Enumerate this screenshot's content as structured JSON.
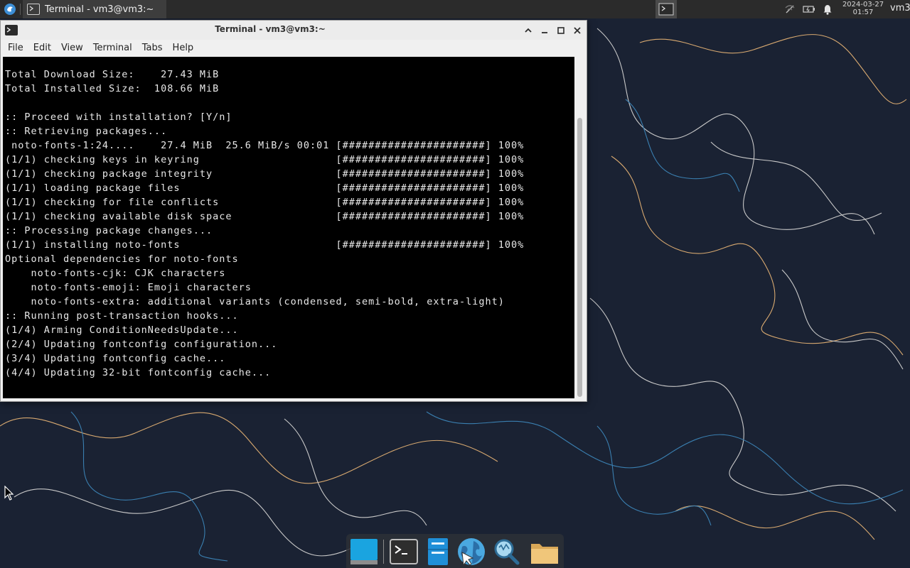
{
  "top_panel": {
    "task_label": "Terminal - vm3@vm3:~",
    "clock_date": "2024-03-27",
    "clock_time": "01:57",
    "user": "vm3",
    "icons": [
      "app-menu-icon",
      "terminal-icon",
      "workspace-icon",
      "network-off-icon",
      "battery-icon",
      "notification-bell-icon"
    ]
  },
  "window": {
    "title": "Terminal - vm3@vm3:~",
    "menu": [
      "File",
      "Edit",
      "View",
      "Terminal",
      "Tabs",
      "Help"
    ]
  },
  "terminal": {
    "lines": [
      "Total Download Size:    27.43 MiB",
      "Total Installed Size:  108.66 MiB",
      "",
      ":: Proceed with installation? [Y/n]",
      ":: Retrieving packages...",
      " noto-fonts-1:24....    27.4 MiB  25.6 MiB/s 00:01 [######################] 100%",
      "(1/1) checking keys in keyring                     [######################] 100%",
      "(1/1) checking package integrity                   [######################] 100%",
      "(1/1) loading package files                        [######################] 100%",
      "(1/1) checking for file conflicts                  [######################] 100%",
      "(1/1) checking available disk space                [######################] 100%",
      ":: Processing package changes...",
      "(1/1) installing noto-fonts                        [######################] 100%",
      "Optional dependencies for noto-fonts",
      "    noto-fonts-cjk: CJK characters",
      "    noto-fonts-emoji: Emoji characters",
      "    noto-fonts-extra: additional variants (condensed, semi-bold, extra-light)",
      ":: Running post-transaction hooks...",
      "(1/4) Arming ConditionNeedsUpdate...",
      "(2/4) Updating fontconfig configuration...",
      "(3/4) Updating fontconfig cache...",
      "(4/4) Updating 32-bit fontconfig cache..."
    ]
  },
  "dock": {
    "items": [
      "show-desktop-icon",
      "terminal-icon",
      "file-manager-icon",
      "web-browser-icon",
      "search-icon",
      "folder-icon"
    ]
  },
  "colors": {
    "panel_bg": "#2b2b2b",
    "terminal_bg": "#000000",
    "terminal_fg": "#e8e8e8",
    "wallpaper_bg": "#1a2233"
  }
}
